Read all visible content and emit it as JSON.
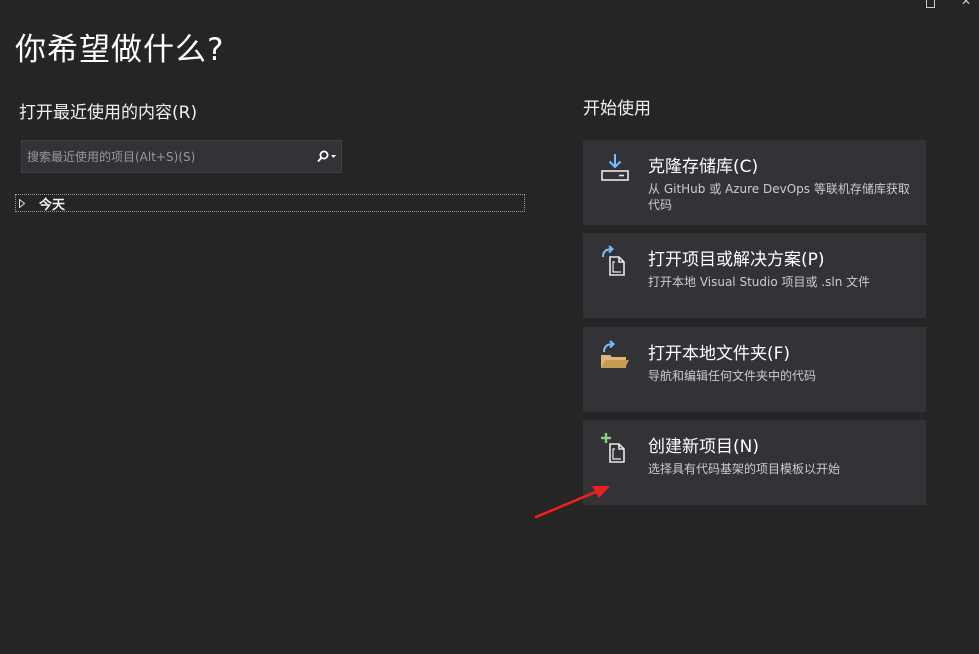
{
  "window": {
    "controls": [
      "restore-icon",
      "close-icon"
    ]
  },
  "page": {
    "title": "你希望做什么?"
  },
  "recent": {
    "title": "打开最近使用的内容(R)",
    "search_placeholder": "搜索最近使用的项目(Alt+S)(S)",
    "search_icon": "search-icon",
    "groups": [
      {
        "label": "今天"
      }
    ]
  },
  "start": {
    "title": "开始使用",
    "cards": [
      {
        "icon": "clone-download-icon",
        "title": "克隆存储库(C)",
        "description": "从 GitHub 或 Azure DevOps 等联机存储库获取代码"
      },
      {
        "icon": "open-project-icon",
        "title": "打开项目或解决方案(P)",
        "description": "打开本地 Visual Studio 项目或 .sln 文件"
      },
      {
        "icon": "open-folder-icon",
        "title": "打开本地文件夹(F)",
        "description": "导航和编辑任何文件夹中的代码"
      },
      {
        "icon": "new-project-icon",
        "title": "创建新项目(N)",
        "description": "选择具有代码基架的项目模板以开始"
      }
    ]
  },
  "colors": {
    "background": "#252526",
    "card": "#333337",
    "accent_blue": "#75beff",
    "folder_yellow": "#dcb67a",
    "add_green": "#89d185",
    "annotation_red": "#e8211e"
  }
}
